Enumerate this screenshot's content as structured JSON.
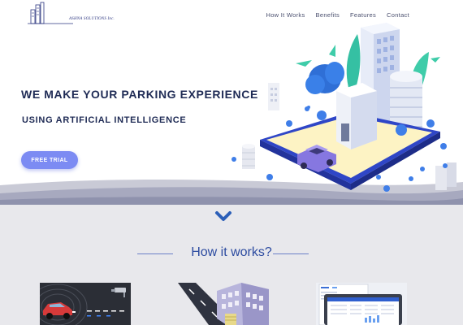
{
  "brand": {
    "name": "ASHNA SOLUTIONS Inc."
  },
  "nav": {
    "items": [
      "How It Works",
      "Benefits",
      "Features",
      "Contact"
    ]
  },
  "hero": {
    "headline": "WE MAKE YOUR PARKING EXPERIENCE",
    "subheadline": "USING ARTIFICIAL INTELLIGENCE",
    "cta_label": "FREE TRIAL"
  },
  "how_it_works": {
    "title": "How it works?"
  },
  "colors": {
    "accent": "#7c8bf3",
    "navy": "#1f2b55",
    "section_bg": "#e8e8ec",
    "title_blue": "#2c4ba0"
  }
}
